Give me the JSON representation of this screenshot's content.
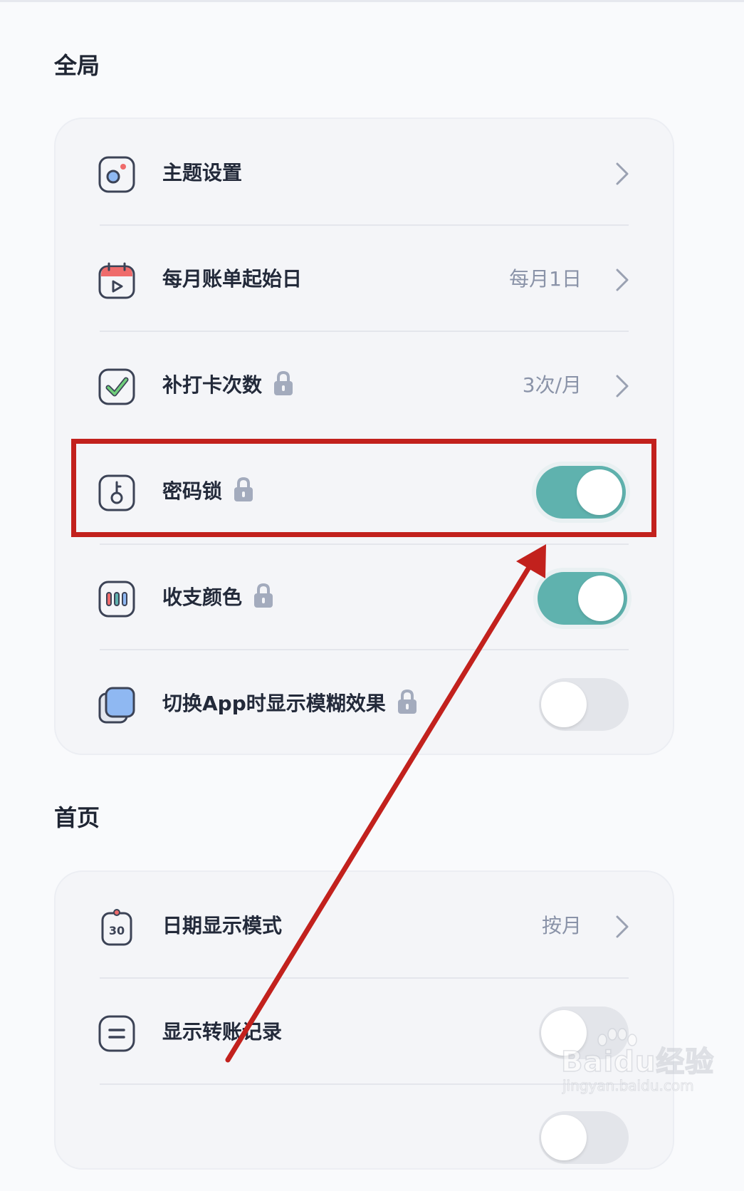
{
  "sections": [
    {
      "title": "全局",
      "rows": [
        {
          "label": "主题设置",
          "icon": "theme-icon",
          "locked": false,
          "value": "",
          "control": "chevron"
        },
        {
          "label": "每月账单起始日",
          "icon": "calendar-icon",
          "locked": false,
          "value": "每月1日",
          "control": "chevron"
        },
        {
          "label": "补打卡次数",
          "icon": "check-icon",
          "locked": true,
          "value": "3次/月",
          "control": "chevron"
        },
        {
          "label": "密码锁",
          "icon": "key-icon",
          "locked": true,
          "value": "",
          "control": "toggle",
          "toggle_on": true
        },
        {
          "label": "收支颜色",
          "icon": "color-bars-icon",
          "locked": true,
          "value": "",
          "control": "toggle",
          "toggle_on": true
        },
        {
          "label": "切换App时显示模糊效果",
          "icon": "blur-window-icon",
          "locked": true,
          "value": "",
          "control": "toggle",
          "toggle_on": false
        }
      ]
    },
    {
      "title": "首页",
      "rows": [
        {
          "label": "日期显示模式",
          "icon": "date-30-icon",
          "locked": false,
          "value": "按月",
          "control": "chevron"
        },
        {
          "label": "显示转账记录",
          "icon": "transfer-icon",
          "locked": false,
          "value": "",
          "control": "toggle",
          "toggle_on": false
        }
      ]
    }
  ],
  "colors": {
    "accent_toggle": "#5fb2ae",
    "annotation_red": "#c2211d",
    "lock_gray": "#a3abbd"
  },
  "watermark": {
    "brand": "Baidu经验",
    "url": "jingyan.baidu.com"
  }
}
